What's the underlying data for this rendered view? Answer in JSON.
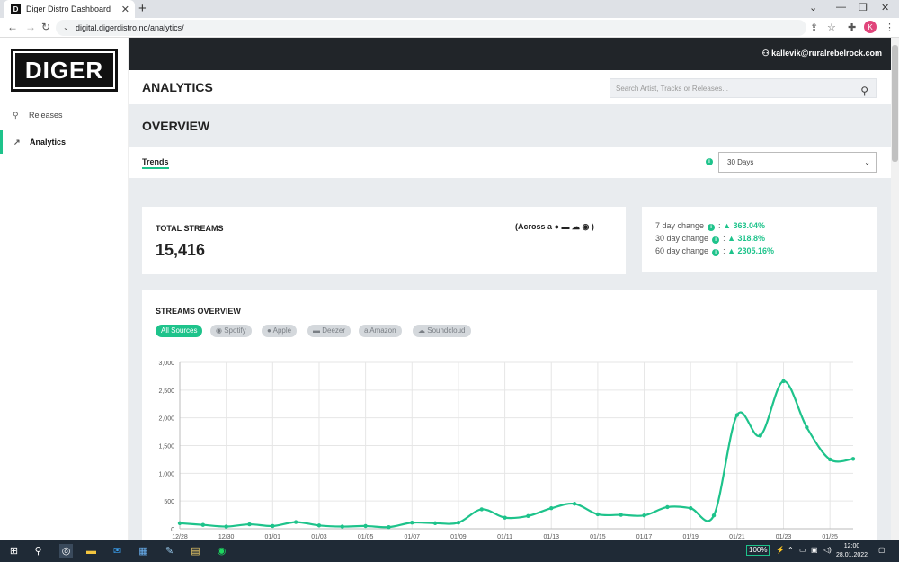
{
  "browser": {
    "tab_title": "Diger Distro Dashboard",
    "tab_favicon_letter": "D",
    "new_tab": "+",
    "url": "digital.digerdistro.no/analytics/",
    "profile_initial": "K"
  },
  "sidebar": {
    "logo": "DIGER",
    "items": [
      {
        "label": "Releases",
        "icon": "rocket-icon"
      },
      {
        "label": "Analytics",
        "icon": "trend-icon",
        "active": true
      }
    ]
  },
  "topbar": {
    "user_email": "kallevik@ruralrebelrock.com"
  },
  "header": {
    "title": "ANALYTICS",
    "search_placeholder": "Search Artist, Tracks or Releases..."
  },
  "overview": {
    "title": "OVERVIEW",
    "tab": "Trends",
    "range_selected": "30 Days"
  },
  "total": {
    "label": "TOTAL STREAMS",
    "value": "15,416",
    "across_label": "(Across",
    "across_close": ")"
  },
  "changes": [
    {
      "label": "7 day change",
      "value": "363.04%"
    },
    {
      "label": "30 day change",
      "value": "318.8%"
    },
    {
      "label": "60 day change",
      "value": "2305.16%"
    }
  ],
  "streams": {
    "title": "STREAMS OVERVIEW",
    "sources": [
      "All Sources",
      "Spotify",
      "Apple",
      "Deezer",
      "Amazon",
      "Soundcloud"
    ],
    "active_source": "All Sources"
  },
  "chart_data": {
    "type": "line",
    "x": [
      "12/28",
      "12/29",
      "12/30",
      "12/31",
      "01/01",
      "01/02",
      "01/03",
      "01/04",
      "01/05",
      "01/06",
      "01/07",
      "01/08",
      "01/09",
      "01/10",
      "01/11",
      "01/12",
      "01/13",
      "01/14",
      "01/15",
      "01/16",
      "01/17",
      "01/18",
      "01/19",
      "01/20",
      "01/21",
      "01/22",
      "01/23",
      "01/24",
      "01/25",
      "01/26"
    ],
    "tick_labels": [
      "12/28",
      "12/30",
      "01/01",
      "01/03",
      "01/05",
      "01/07",
      "01/09",
      "01/11",
      "01/13",
      "01/15",
      "01/17",
      "01/19",
      "01/21",
      "01/23",
      "01/25"
    ],
    "series": [
      {
        "values": [
          100,
          70,
          40,
          80,
          50,
          120,
          60,
          40,
          50,
          30,
          110,
          100,
          110,
          350,
          200,
          230,
          370,
          450,
          260,
          250,
          240,
          390,
          370,
          240,
          2050,
          1680,
          2660,
          1830,
          1250,
          1260
        ]
      }
    ],
    "ylim": [
      0,
      3000
    ],
    "yticks": [
      "0",
      "500",
      "1,000",
      "1,500",
      "2,000",
      "2,500",
      "3,000"
    ],
    "grid": true,
    "color": "#1ec38b"
  },
  "taskbar": {
    "battery": "100%",
    "time": "12:00",
    "date": "28.01.2022"
  }
}
